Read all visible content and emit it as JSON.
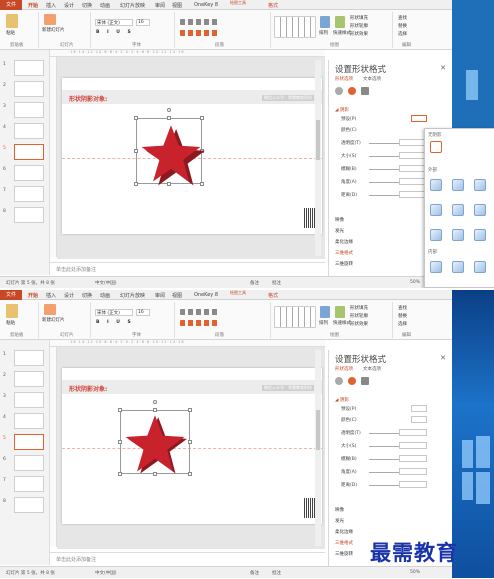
{
  "ribbon": {
    "file_tab": "文件",
    "tabs": [
      "开始",
      "插入",
      "设计",
      "切换",
      "动画",
      "幻灯片放映",
      "审阅",
      "视图",
      "OneKey 8",
      "格式"
    ],
    "context_label": "绘图工具",
    "groups": [
      "剪贴板",
      "幻灯片",
      "字体",
      "段落",
      "绘图",
      "编辑"
    ],
    "font_name": "宋体 (正文)",
    "font_size": "16",
    "paste": "粘贴",
    "new_slide": "新建幻灯片",
    "shape_fill": "形状填充",
    "shape_outline": "形状轮廓",
    "shape_effects": "形状效果",
    "arrange": "排列",
    "quick_styles": "快速样式",
    "find": "查找",
    "replace": "替换",
    "select": "选择"
  },
  "slides": {
    "numbers": [
      "1",
      "2",
      "3",
      "4",
      "5",
      "6",
      "7",
      "8"
    ],
    "selected": "5"
  },
  "slide": {
    "title": "形状阴影对象:",
    "subtitle": "微信公众号：常需教育科技"
  },
  "notes_placeholder": "单击此处添加备注",
  "status": {
    "slide_info": "幻灯片 第 5 张，共 8 张",
    "language": "中文(中国)",
    "notes": "备注",
    "comments": "批注",
    "zoom": "50%"
  },
  "panel": {
    "title": "设置形状格式",
    "tab_shape": "形状选项",
    "tab_text": "文本选项",
    "section_shadow": "阴影",
    "preset": "预设(P)",
    "color": "颜色(C)",
    "transparency": "透明度(T)",
    "size": "大小(S)",
    "blur": "模糊(B)",
    "angle": "角度(A)",
    "distance": "距离(D)",
    "reflection": "映像",
    "glow": "发光",
    "soft_edges": "柔化边缘",
    "three_d_format": "三维格式",
    "three_d_rotation": "三维旋转"
  },
  "gallery": {
    "no_shadow": "无阴影",
    "outer": "外部",
    "inner": "内部"
  },
  "watermark": "最需教育",
  "colors": {
    "accent": "#c64824",
    "star": "#c8232d",
    "desktop": "#1e6fb8"
  }
}
